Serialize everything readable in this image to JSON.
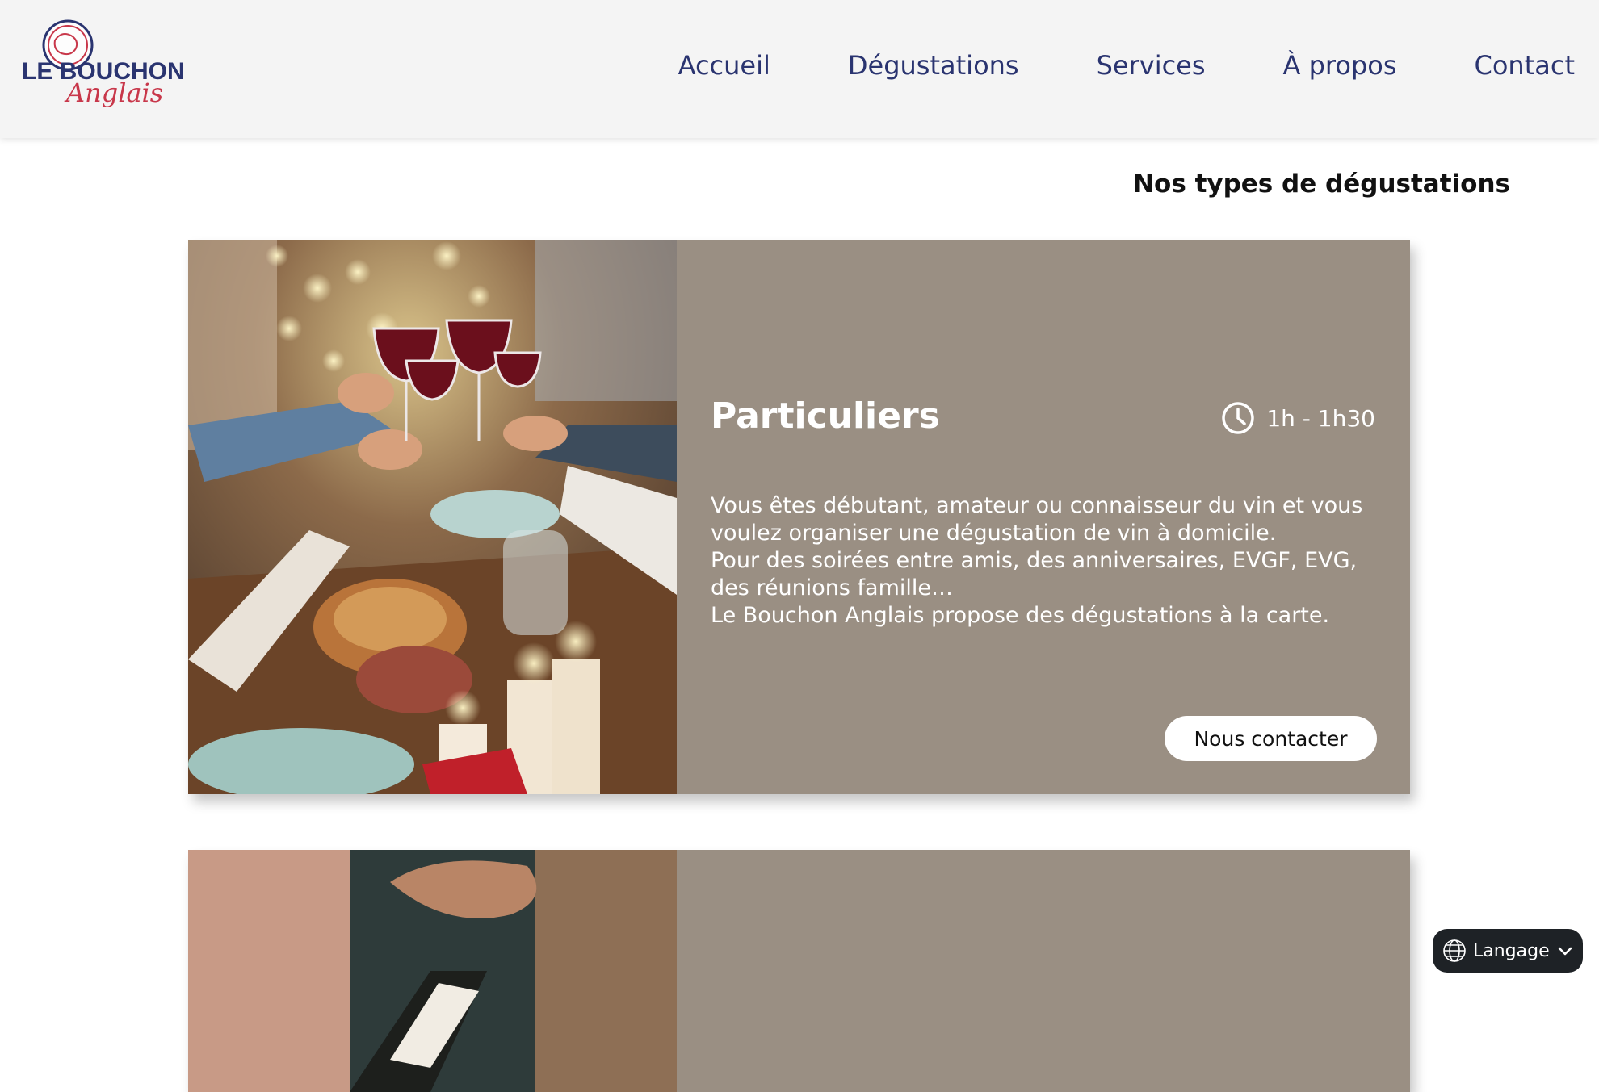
{
  "logo": {
    "line1": "LE BOUCHON",
    "line2": "Anglais",
    "colors": {
      "navy": "#2a3470",
      "red": "#c8374a"
    }
  },
  "nav": {
    "items": [
      {
        "label": "Accueil"
      },
      {
        "label": "Dégustations"
      },
      {
        "label": "Services"
      },
      {
        "label": "À propos"
      },
      {
        "label": "Contact"
      }
    ]
  },
  "section_title": "Nos types de dégustations",
  "cards": [
    {
      "image": "wine-toast-dinner-photo",
      "title": "Particuliers",
      "duration": "1h - 1h30",
      "description": "Vous êtes débutant, amateur ou connaisseur du vin et vous\nvoulez organiser une dégustation de vin à domicile.\nPour des soirées entre amis, des anniversaires, EVGF, EVG,\ndes réunions famille…\nLe Bouchon Anglais propose des dégustations à la carte.",
      "button_label": "Nous contacter"
    },
    {
      "image": "wine-bottle-pouring-photo"
    }
  ],
  "language_button": {
    "label": "Langage"
  },
  "colors": {
    "header_bg": "#f4f4f4",
    "card_bg": "#9a8f83",
    "nav_text": "#2a3470"
  }
}
